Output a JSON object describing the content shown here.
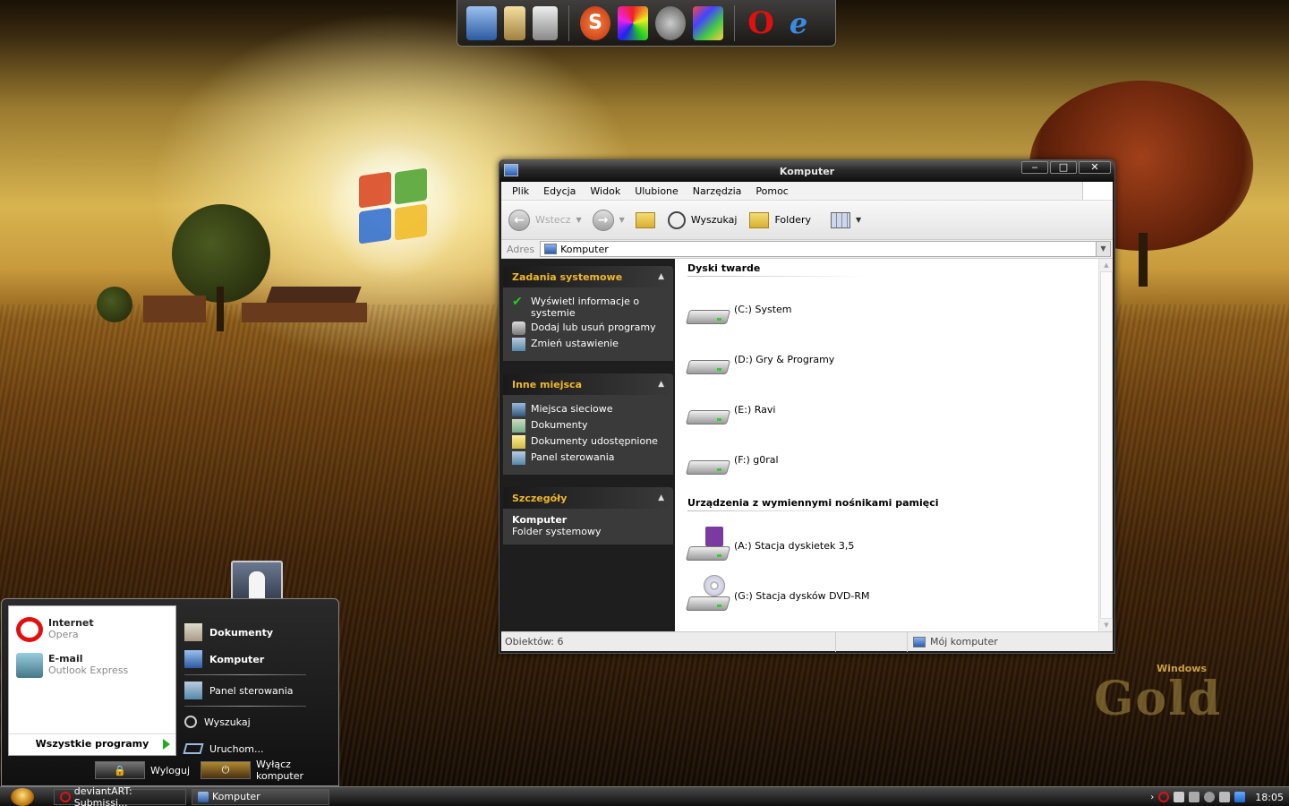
{
  "dock": {
    "icons": [
      "computer-icon",
      "library-icon",
      "recycle-bin-icon",
      "s-app-icon",
      "media-icon",
      "gimp-icon",
      "paint-icon",
      "opera-icon",
      "internet-explorer-icon"
    ]
  },
  "window": {
    "title": "Komputer",
    "menu": [
      "Plik",
      "Edycja",
      "Widok",
      "Ulubione",
      "Narzędzia",
      "Pomoc"
    ],
    "toolbar": {
      "back_label": "Wstecz",
      "search_label": "Wyszukaj",
      "folders_label": "Foldery"
    },
    "address": {
      "label": "Adres",
      "value": "Komputer"
    },
    "taskpane": {
      "system_tasks": {
        "title": "Zadania systemowe",
        "items": [
          "Wyświetl informacje o systemie",
          "Dodaj lub usuń programy",
          "Zmień ustawienie"
        ]
      },
      "other_places": {
        "title": "Inne miejsca",
        "items": [
          "Miejsca sieciowe",
          "Dokumenty",
          "Dokumenty udostępnione",
          "Panel sterowania"
        ]
      },
      "details": {
        "title": "Szczegóły",
        "name": "Komputer",
        "type": "Folder systemowy"
      }
    },
    "groups": {
      "hard_drives": {
        "title": "Dyski twarde",
        "items": [
          "(C:) System",
          "(D:) Gry & Programy",
          "(E:) Ravi",
          "(F:) g0ral"
        ]
      },
      "removable": {
        "title": "Urządzenia z wymiennymi nośnikami pamięci",
        "items": [
          "(A:) Stacja dyskietek 3,5",
          "(G:) Stacja dysków DVD-RM"
        ]
      }
    },
    "status": {
      "objects": "Obiektów: 6",
      "location": "Mój komputer"
    }
  },
  "startmenu": {
    "pinned": [
      {
        "title": "Internet",
        "sub": "Opera"
      },
      {
        "title": "E-mail",
        "sub": "Outlook Express"
      }
    ],
    "all_programs": "Wszystkie programy",
    "right": {
      "documents": "Dokumenty",
      "computer": "Komputer",
      "control_panel": "Panel sterowania",
      "search": "Wyszukaj",
      "run": "Uruchom..."
    },
    "logoff": "Wyloguj",
    "shutdown": "Wyłącz komputer"
  },
  "taskbar": {
    "tasks": [
      "deviantART: Submissi...",
      "Komputer"
    ],
    "clock": "18:05"
  },
  "branding": {
    "line1": "Windows",
    "line2": "Gold"
  }
}
